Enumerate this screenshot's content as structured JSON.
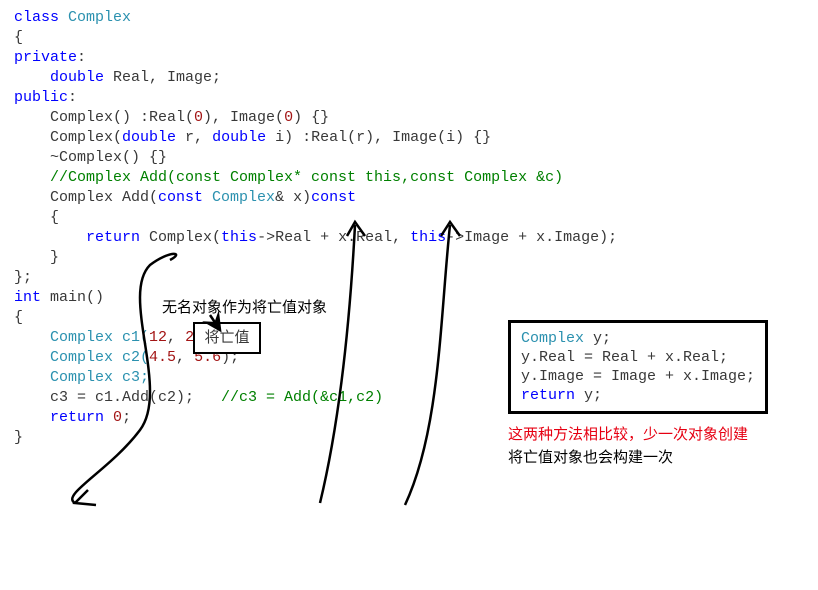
{
  "code": {
    "class_decl_kw": "class",
    "class_name": " Complex",
    "open_brace": "{",
    "private_kw": "private",
    "colon": ":",
    "double_kw": "double",
    "fields": " Real, Image;",
    "public_kw": "public",
    "ctor0": "Complex() :Real(0), Image(0) {}",
    "ctor0_pre": "    Complex() :Real(",
    "ctor0_a": "0",
    "ctor0_mid": "), Image(",
    "ctor0_b": "0",
    "ctor0_end": ") {}",
    "ctor1_pre": "    Complex(",
    "ctor1_double1": "double",
    "ctor1_r": " r, ",
    "ctor1_double2": "double",
    "ctor1_i": " i) :Real(r), Image(i) {}",
    "dtor": "    ~Complex() {}",
    "comment_add": "    //Complex Add(const Complex* const this,const Complex &c)",
    "add_pre": "    Complex Add(",
    "add_const1": "const",
    "add_type": " Complex",
    "add_amp": "& ",
    "add_x": "x)",
    "add_const2": "const",
    "open2": "    {",
    "blank": "",
    "return_line_pre": "        ",
    "return_kw": "return",
    "return_body": " Complex(",
    "return_this1": "this",
    "return_arrow1": "->Real + x.Real, ",
    "return_this2": "this",
    "return_arrow2": "->Image + x.Image);",
    "close2": "    }",
    "close1": "};",
    "int_kw": "int",
    "main": " main()",
    "open3": "{",
    "c1_pre": "    Complex c1(",
    "c1_a": "12",
    "c1_mid": ", ",
    "c1_b": "23",
    "c1_end": ");",
    "c2_pre": "    Complex c2(",
    "c2_a": "4.5",
    "c2_mid": ", ",
    "c2_b": "5.6",
    "c2_end": ");",
    "c3_decl": "    Complex c3;",
    "assign_pre": "    c3 = c1.Add(c2);   ",
    "assign_comment": "//c3 = Add(&c1,c2)",
    "return0_pre": "    ",
    "return0_kw": "return",
    "return0_body": " ",
    "return0_zero": "0",
    "return0_semi": ";",
    "close3": "}"
  },
  "anno": {
    "label": "无名对象作为将亡值对象",
    "xvalue": "将亡值"
  },
  "rightbox": {
    "l1_type": "Complex",
    "l1_rest": " y;",
    "l2": "y.Real = Real + x.Real;",
    "l3": "y.Image = Image + x.Image;",
    "l4_kw": "return",
    "l4_rest": " y;"
  },
  "notes": {
    "red": "这两种方法相比较，少一次对象创建",
    "black": "将亡值对象也会构建一次"
  }
}
